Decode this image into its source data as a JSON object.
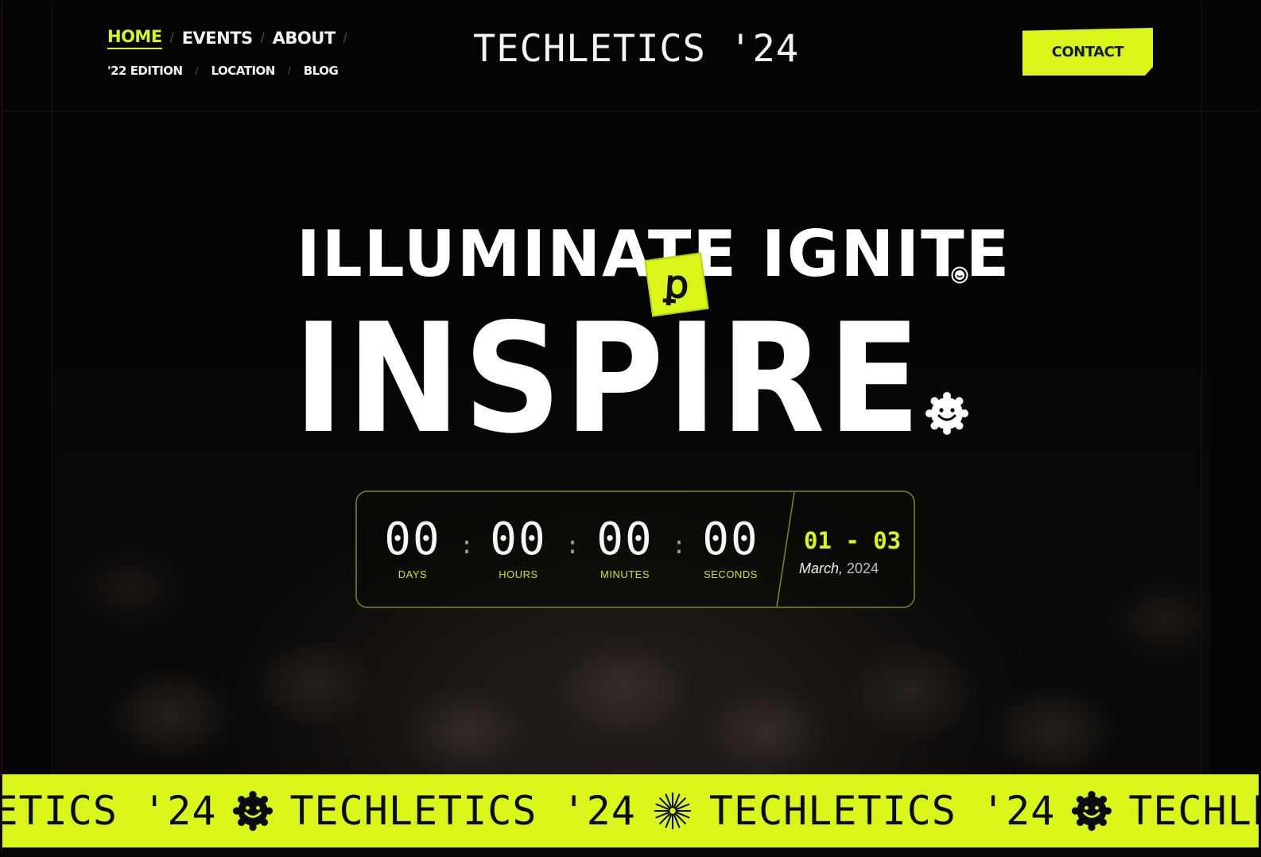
{
  "header": {
    "nav_primary": [
      "HOME",
      "EVENTS",
      "ABOUT"
    ],
    "nav_secondary": [
      "'22 EDITION",
      "LOCATION",
      "BLOG"
    ],
    "logo": "TECHLETICS '24",
    "contact_label": "CONTACT",
    "separator": "/"
  },
  "hero": {
    "line1": "ILLUMINATE IGNITE",
    "line2": "INSPIRE",
    "sticker_glyph": "ꝑ"
  },
  "countdown": {
    "units": [
      {
        "value": "00",
        "label": "DAYS"
      },
      {
        "value": "00",
        "label": "HOURS"
      },
      {
        "value": "00",
        "label": "MINUTES"
      },
      {
        "value": "00",
        "label": "SECONDS"
      }
    ],
    "colon": ":",
    "date_range": "01 - 03",
    "month": "March,",
    "year": "2024"
  },
  "marquee": {
    "text": "TECHLETICS '24",
    "icons": [
      "smiley-sun-icon",
      "starburst-icon",
      "smiley-sun-icon"
    ]
  },
  "colors": {
    "accent": "#d9f51a",
    "background": "#040404",
    "text": "#ffffff"
  }
}
